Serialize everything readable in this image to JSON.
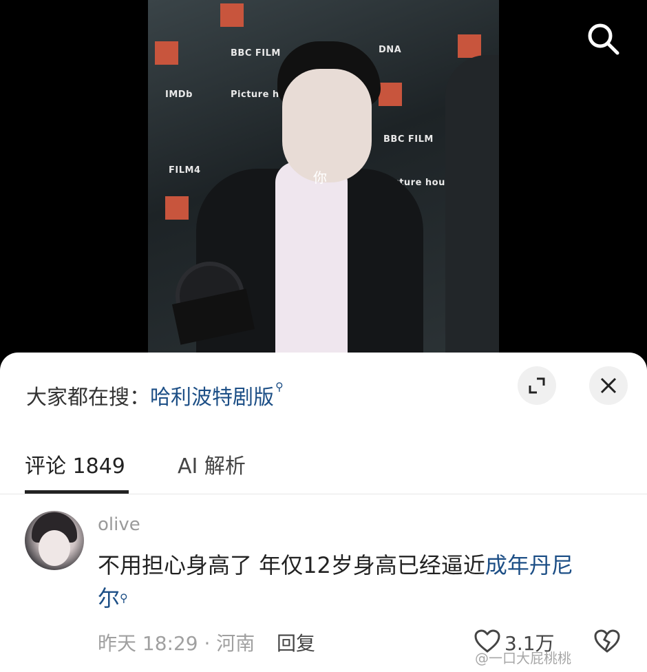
{
  "video": {
    "backdrop_logos": [
      "BBC FILM",
      "IMDb",
      "FILM4",
      "Picture house",
      "DNA",
      "BBC FILM",
      "Picture house"
    ],
    "overlay_text": "你"
  },
  "header": {
    "search_icon": "search-icon"
  },
  "sheet": {
    "search_prompt_label": "大家都在搜：",
    "search_term": "哈利波特剧版",
    "expand_icon": "expand-icon",
    "close_icon": "close-icon"
  },
  "tabs": [
    {
      "label": "评论 1849",
      "active": true
    },
    {
      "label": "AI 解析",
      "active": false
    }
  ],
  "comment": {
    "username": "olive",
    "text_plain": "不用担心身高了 年仅12岁身高已经逼近",
    "text_link_line1": "成年丹尼",
    "text_link_line2": "尔",
    "time_location": "昨天 18:29 · 河南",
    "reply_label": "回复",
    "like_count": "3.1万"
  },
  "watermark": "@一口大屁桃桃",
  "colors": {
    "link": "#1d4f86",
    "background": "#ffffff",
    "video_bg": "#000000"
  }
}
